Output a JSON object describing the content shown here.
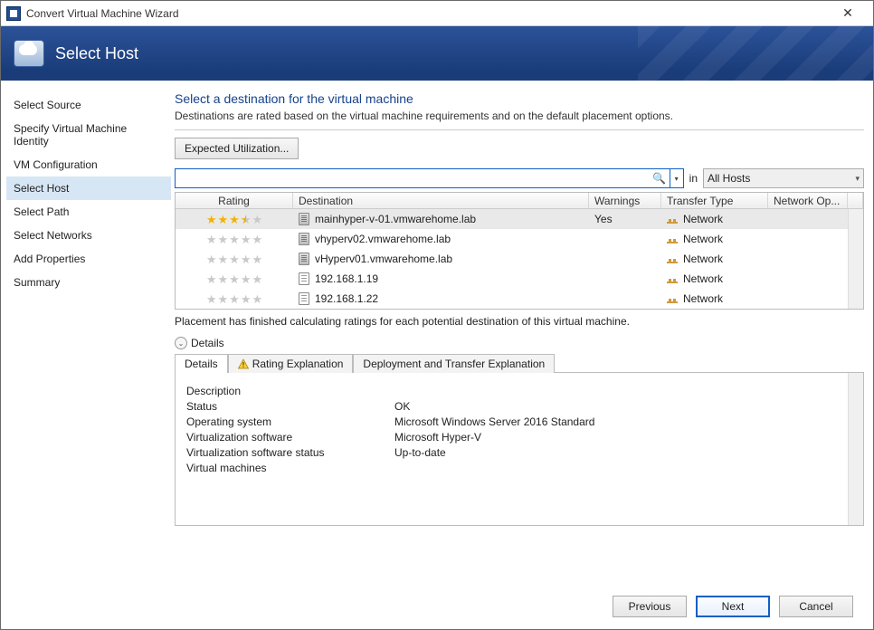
{
  "window": {
    "title": "Convert Virtual Machine Wizard"
  },
  "banner": {
    "heading": "Select Host"
  },
  "sidebar": {
    "steps": [
      "Select Source",
      "Specify Virtual Machine Identity",
      "VM Configuration",
      "Select Host",
      "Select Path",
      "Select Networks",
      "Add Properties",
      "Summary"
    ],
    "active_index": 3
  },
  "main": {
    "heading": "Select a destination for the virtual machine",
    "description": "Destinations are rated based on the virtual machine requirements and on the default placement options.",
    "expected_btn": "Expected Utilization...",
    "search": {
      "value": "",
      "in_label": "in",
      "scope": "All Hosts"
    },
    "columns": {
      "rating": "Rating",
      "destination": "Destination",
      "warnings": "Warnings",
      "transfer": "Transfer Type",
      "network": "Network Op..."
    },
    "rows": [
      {
        "rating": 3.5,
        "icon": "server",
        "destination": "mainhyper-v-01.vmwarehome.lab",
        "warnings": "Yes",
        "transfer": "Network",
        "selected": true
      },
      {
        "rating": 0,
        "icon": "server",
        "destination": "vhyperv02.vmwarehome.lab",
        "warnings": "",
        "transfer": "Network",
        "selected": false
      },
      {
        "rating": 0,
        "icon": "server",
        "destination": "vHyperv01.vmwarehome.lab",
        "warnings": "",
        "transfer": "Network",
        "selected": false
      },
      {
        "rating": 0,
        "icon": "library",
        "destination": "192.168.1.19",
        "warnings": "",
        "transfer": "Network",
        "selected": false
      },
      {
        "rating": 0,
        "icon": "library",
        "destination": "192.168.1.22",
        "warnings": "",
        "transfer": "Network",
        "selected": false
      }
    ],
    "placement_msg": "Placement has finished calculating ratings for each potential destination of this virtual machine.",
    "details_label": "Details",
    "tabs": {
      "details": "Details",
      "rating": "Rating Explanation",
      "deploy": "Deployment and Transfer Explanation",
      "active": 0
    },
    "detail_rows": [
      {
        "k": "Description",
        "v": ""
      },
      {
        "k": "Status",
        "v": "OK"
      },
      {
        "k": "Operating system",
        "v": "Microsoft Windows Server 2016 Standard"
      },
      {
        "k": "Virtualization software",
        "v": "Microsoft Hyper-V"
      },
      {
        "k": "Virtualization software status",
        "v": "Up-to-date"
      },
      {
        "k": "Virtual machines",
        "v": ""
      }
    ]
  },
  "footer": {
    "previous": "Previous",
    "next": "Next",
    "cancel": "Cancel"
  }
}
